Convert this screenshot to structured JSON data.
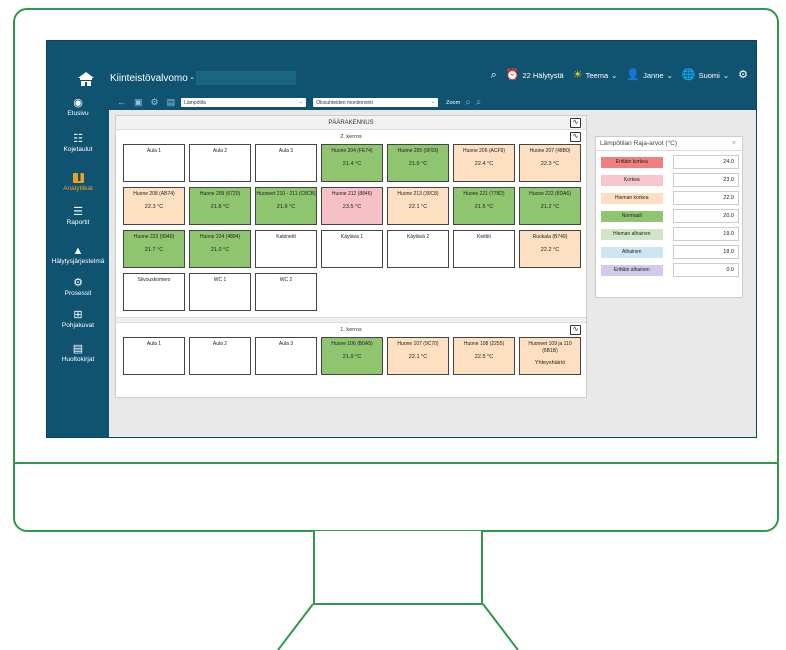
{
  "header": {
    "app_title": "Kiinteistövalvomo -",
    "alarms": "22 Hälytystä",
    "theme": "Teema",
    "user": "Janne",
    "language": "Suomi"
  },
  "sidebar": {
    "items": [
      {
        "label": "Etusivu",
        "icon": "compass-icon"
      },
      {
        "label": "Kojetaulut",
        "icon": "dashboard-icon"
      },
      {
        "label": "Analytiikat",
        "icon": "analytics-icon"
      },
      {
        "label": "Raportit",
        "icon": "report-icon"
      },
      {
        "label": "Hälytysjärjestelmä",
        "icon": "alert-icon"
      },
      {
        "label": "Prosessit",
        "icon": "process-icon"
      },
      {
        "label": "Pohjakuvat",
        "icon": "floorplan-icon"
      },
      {
        "label": "Huoltokirjat",
        "icon": "logbook-icon"
      }
    ]
  },
  "toolbar": {
    "measure_select": "Lämpötila",
    "mode_select": "Olosuhteiden monitorointi",
    "zoom_label": "Zoom"
  },
  "building": {
    "title": "PÄÄRAKENNUS",
    "floors": [
      {
        "title": "2. kerros",
        "rooms": [
          {
            "name": "Aula 1",
            "value": "",
            "status": "none"
          },
          {
            "name": "Aula 2",
            "value": "",
            "status": "none"
          },
          {
            "name": "Aula 3",
            "value": "",
            "status": "none"
          },
          {
            "name": "Huone 204 (FE74)",
            "value": "21.4 °C",
            "status": "normal"
          },
          {
            "name": "Huone 205 (0F93)",
            "value": "21.9 °C",
            "status": "normal"
          },
          {
            "name": "Huone 206 (ACF9)",
            "value": "22.4 °C",
            "status": "slight-high"
          },
          {
            "name": "Huone 207 (48B0)",
            "value": "22.3 °C",
            "status": "slight-high"
          },
          {
            "name": "Huone 208 (AB74)",
            "value": "22.3 °C",
            "status": "slight-high"
          },
          {
            "name": "Huone 209 (6720)",
            "value": "21.8 °C",
            "status": "normal"
          },
          {
            "name": "Huoneet 210 - 211 (C8CB)",
            "value": "21.9 °C",
            "status": "normal"
          },
          {
            "name": "Huone 212 (8846)",
            "value": "23.5 °C",
            "status": "high"
          },
          {
            "name": "Huone 213 (30C8)",
            "value": "22.1 °C",
            "status": "slight-high"
          },
          {
            "name": "Huone 221 (778D)",
            "value": "21.5 °C",
            "status": "normal"
          },
          {
            "name": "Huone 222 (8DA6)",
            "value": "21.2 °C",
            "status": "normal"
          },
          {
            "name": "Huone 223 (9940)",
            "value": "21.7 °C",
            "status": "normal"
          },
          {
            "name": "Huone 224 (4894)",
            "value": "21.0 °C",
            "status": "normal"
          },
          {
            "name": "Kabinetti",
            "value": "",
            "status": "none"
          },
          {
            "name": "Käytävä 1",
            "value": "",
            "status": "none"
          },
          {
            "name": "Käytävä 2",
            "value": "",
            "status": "none"
          },
          {
            "name": "Keittiö",
            "value": "",
            "status": "none"
          },
          {
            "name": "Ruokala (B749)",
            "value": "22.2 °C",
            "status": "slight-high"
          },
          {
            "name": "Siivouskomero",
            "value": "",
            "status": "none"
          },
          {
            "name": "WC 1",
            "value": "",
            "status": "none"
          },
          {
            "name": "WC 2",
            "value": "",
            "status": "none"
          }
        ]
      },
      {
        "title": "1. kerros",
        "rooms": [
          {
            "name": "Aula 1",
            "value": "",
            "status": "none"
          },
          {
            "name": "Aula 2",
            "value": "",
            "status": "none"
          },
          {
            "name": "Aula 3",
            "value": "",
            "status": "none"
          },
          {
            "name": "Huone 106 (B0A5)",
            "value": "21.9 °C",
            "status": "normal"
          },
          {
            "name": "Huone 107 (9C70)",
            "value": "22.1 °C",
            "status": "slight-high"
          },
          {
            "name": "Huone 108 (2255)",
            "value": "22.5 °C",
            "status": "slight-high"
          },
          {
            "name": "Huoneet 109 ja 110 (6B1B)",
            "value": "Yhteyshäiriö",
            "status": "slight-high"
          }
        ]
      }
    ]
  },
  "limits": {
    "title": "Lämpötilan Raja-arvot (°C)",
    "close": "×",
    "rows": [
      {
        "label": "Erittäin korkea",
        "value": "24.0",
        "color": "#f08080"
      },
      {
        "label": "Korkea",
        "value": "23.0",
        "color": "#f7c6cc"
      },
      {
        "label": "Hieman korkea",
        "value": "22.0",
        "color": "#fde0c1"
      },
      {
        "label": "Normaali",
        "value": "20.0",
        "color": "#8fc56f"
      },
      {
        "label": "Hieman alhainen",
        "value": "19.0",
        "color": "#cfe7c6"
      },
      {
        "label": "Alhainen",
        "value": "18.0",
        "color": "#cbe8f1"
      },
      {
        "label": "Erittäin alhainen",
        "value": "0.0",
        "color": "#cfcbe9"
      }
    ]
  }
}
